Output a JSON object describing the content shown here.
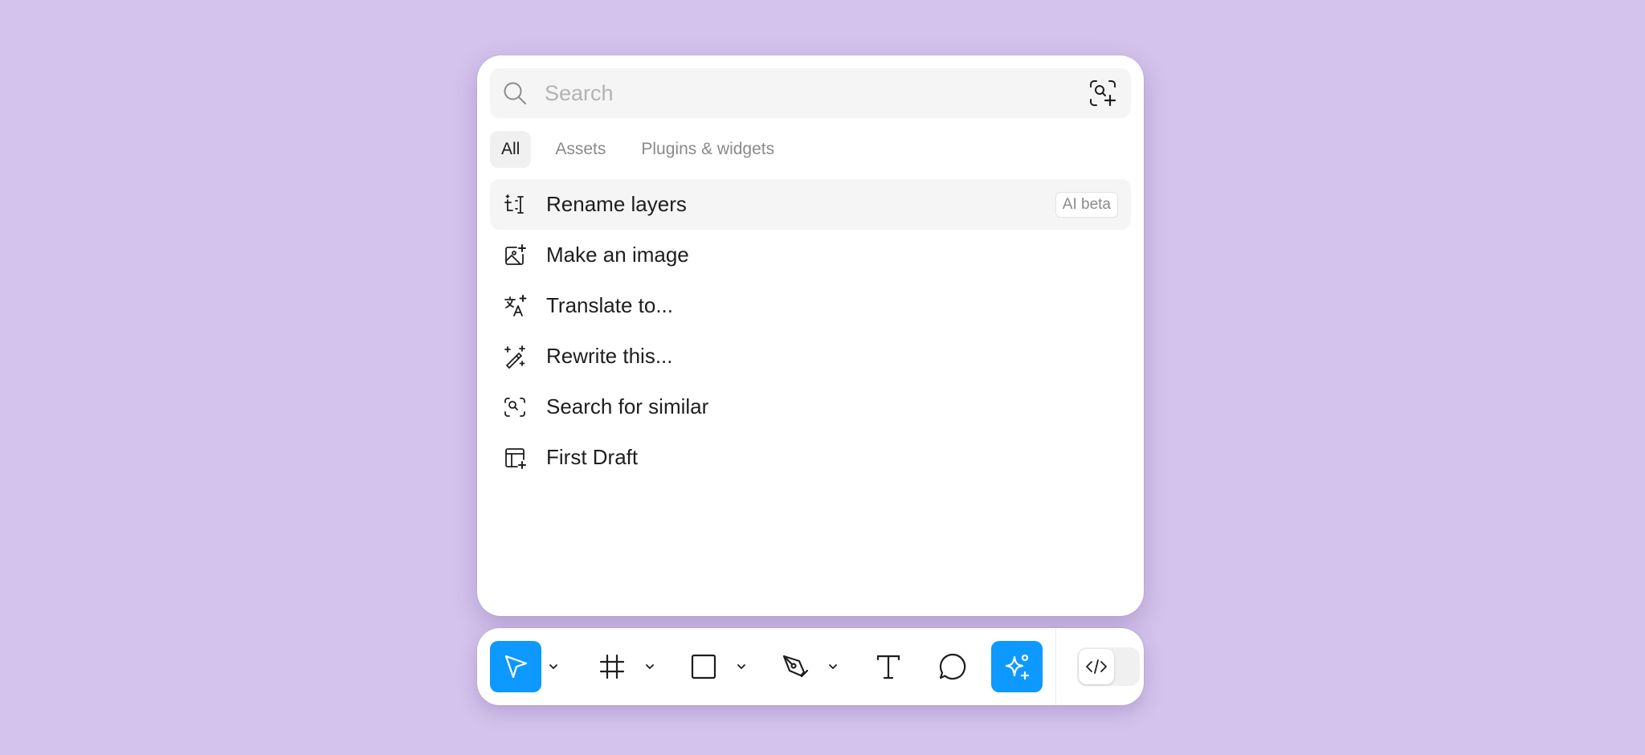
{
  "search": {
    "placeholder": "Search",
    "value": ""
  },
  "tabs": [
    {
      "label": "All",
      "active": true
    },
    {
      "label": "Assets",
      "active": false
    },
    {
      "label": "Plugins & widgets",
      "active": false
    }
  ],
  "actions": [
    {
      "label": "Rename layers",
      "icon": "rename-layers-icon",
      "badge": "AI beta",
      "highlighted": true
    },
    {
      "label": "Make an image",
      "icon": "make-image-icon"
    },
    {
      "label": "Translate to...",
      "icon": "translate-icon"
    },
    {
      "label": "Rewrite this...",
      "icon": "rewrite-wand-icon"
    },
    {
      "label": "Search for similar",
      "icon": "search-similar-icon"
    },
    {
      "label": "First Draft",
      "icon": "first-draft-icon"
    }
  ],
  "toolbar": {
    "tools": [
      {
        "name": "move",
        "icon": "cursor-arrow-icon",
        "active": true,
        "has_menu": true
      },
      {
        "name": "frame",
        "icon": "frame-hash-icon",
        "has_menu": true
      },
      {
        "name": "shape",
        "icon": "rectangle-icon",
        "has_menu": true
      },
      {
        "name": "pen",
        "icon": "pen-icon",
        "has_menu": true
      },
      {
        "name": "text",
        "icon": "text-t-icon"
      },
      {
        "name": "comment",
        "icon": "comment-bubble-icon"
      },
      {
        "name": "actions",
        "icon": "ai-sparkle-icon",
        "active": true
      }
    ],
    "dev_mode_toggle": {
      "icon": "code-brackets-icon",
      "on": false
    }
  },
  "colors": {
    "background": "#d4c3ec",
    "accent": "#0d99ff",
    "panel": "#ffffff",
    "row_highlight": "#f5f5f5"
  }
}
